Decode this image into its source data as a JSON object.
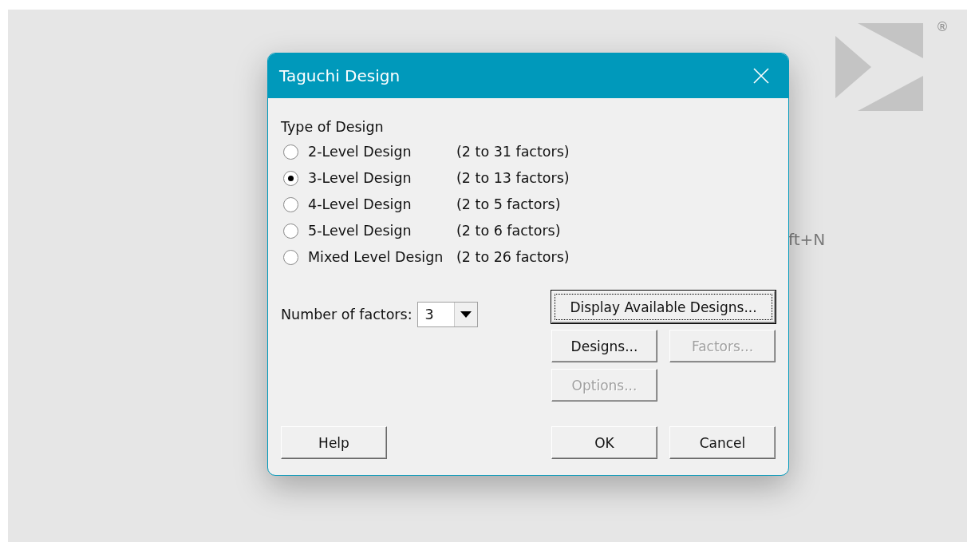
{
  "window": {
    "title": "Taguchi Design"
  },
  "background": {
    "shortcut_fragment": "ft+N",
    "trademark": "®"
  },
  "type_of_design": {
    "label": "Type of Design",
    "options": [
      {
        "label": "2-Level Design",
        "range": "(2 to 31 factors)",
        "selected": false
      },
      {
        "label": "3-Level Design",
        "range": "(2 to 13 factors)",
        "selected": true
      },
      {
        "label": "4-Level Design",
        "range": "(2 to 5 factors)",
        "selected": false
      },
      {
        "label": "5-Level Design",
        "range": "(2 to 6 factors)",
        "selected": false
      },
      {
        "label": "Mixed Level Design",
        "range": "(2 to 26 factors)",
        "selected": false
      }
    ]
  },
  "number_of_factors": {
    "label": "Number of factors:",
    "value": "3"
  },
  "side_buttons": [
    [
      {
        "label": "Display Available Designs...",
        "disabled": false,
        "focused": true
      }
    ],
    [
      {
        "label": "Designs...",
        "disabled": false,
        "focused": false
      },
      {
        "label": "Factors...",
        "disabled": true,
        "focused": false
      }
    ],
    [
      {
        "label": "Options...",
        "disabled": true,
        "focused": false
      }
    ]
  ],
  "footer": {
    "help": {
      "label": "Help"
    },
    "ok": {
      "label": "OK"
    },
    "cancel": {
      "label": "Cancel"
    }
  }
}
